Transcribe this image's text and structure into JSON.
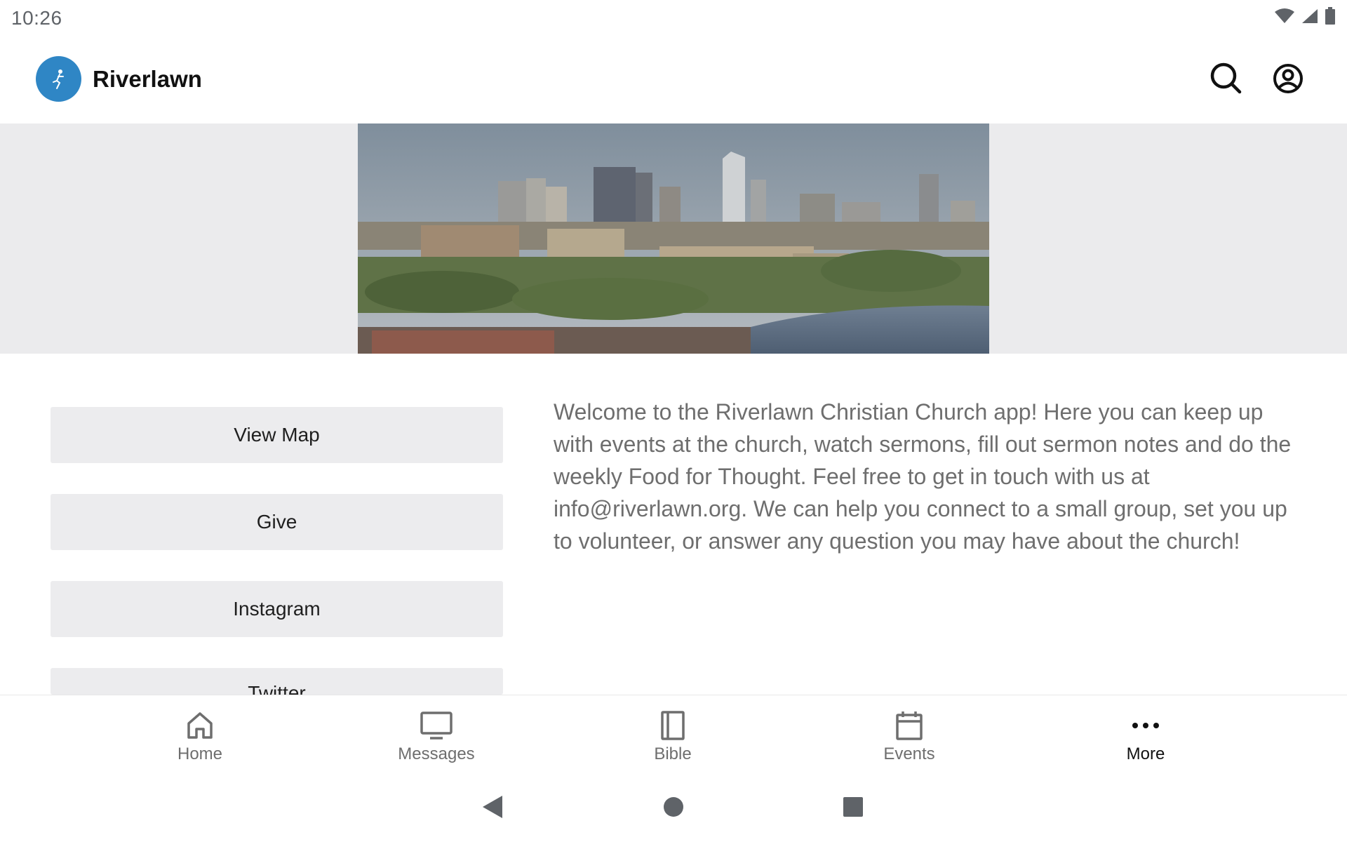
{
  "status_bar": {
    "time": "10:26"
  },
  "header": {
    "app_name": "Riverlawn",
    "brand_color": "#2f86c5"
  },
  "buttons": [
    {
      "label": "View Map"
    },
    {
      "label": "Give"
    },
    {
      "label": "Instagram"
    },
    {
      "label": "Twitter"
    }
  ],
  "welcome": {
    "text": "Welcome to the Riverlawn Christian Church app! Here you can keep up with events at the church, watch sermons, fill out sermon notes and do the weekly Food for Thought. Feel free to get in touch with us at info@riverlawn.org. We can help you connect to a small group, set you up to volunteer, or answer any question you may have about the church!"
  },
  "bottom_nav": {
    "items": [
      {
        "label": "Home",
        "icon": "home-icon"
      },
      {
        "label": "Messages",
        "icon": "tv-icon"
      },
      {
        "label": "Bible",
        "icon": "book-icon"
      },
      {
        "label": "Events",
        "icon": "calendar-icon"
      },
      {
        "label": "More",
        "icon": "more-horizontal-icon",
        "active": true
      }
    ]
  },
  "system_nav": {
    "back": "back-icon",
    "home": "home-circle-icon",
    "recents": "recents-square-icon"
  }
}
